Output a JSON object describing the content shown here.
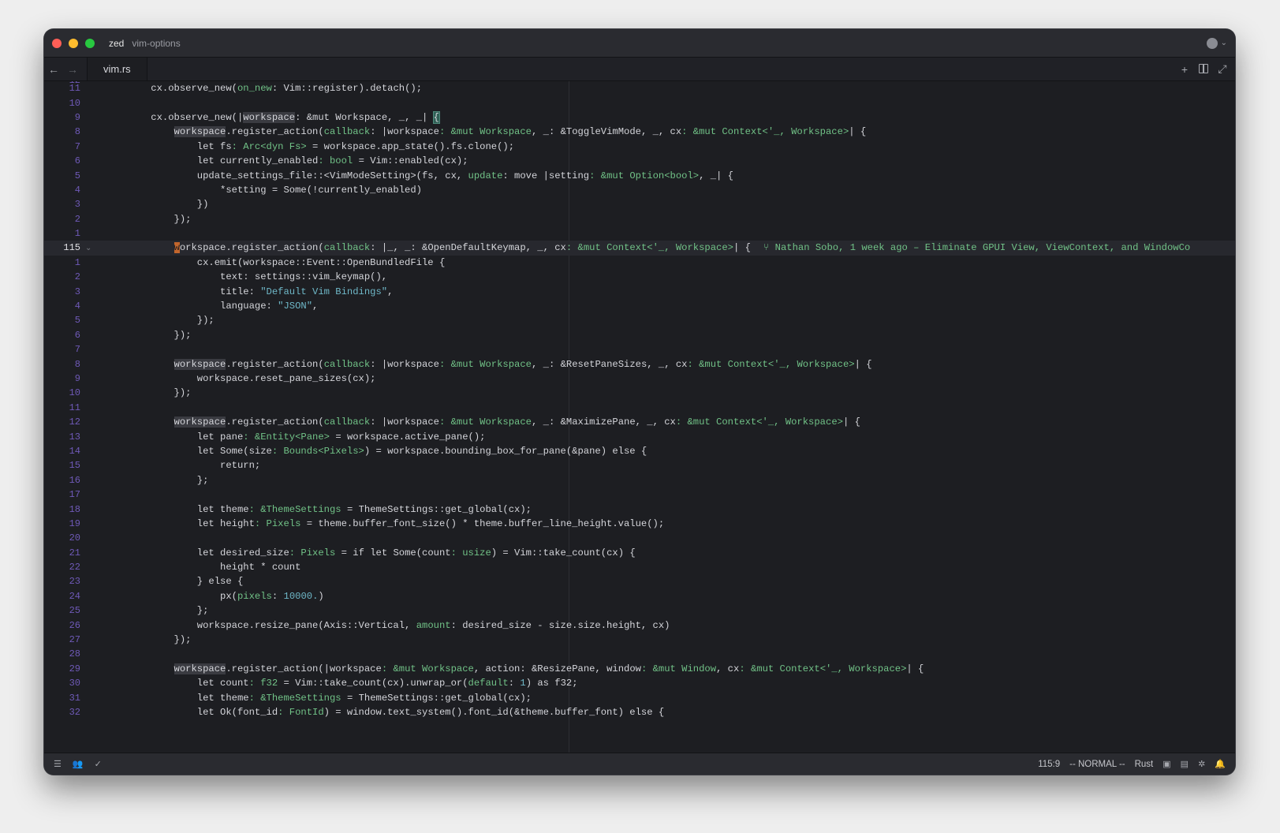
{
  "titlebar": {
    "app_name": "zed",
    "project_name": "vim-options"
  },
  "tabs": [
    {
      "label": "vim.rs",
      "active": true
    }
  ],
  "icons": {
    "back": "arrow-left-icon",
    "forward": "arrow-right-icon",
    "new": "plus-icon",
    "split": "split-pane-icon",
    "zoom": "expand-icon"
  },
  "editor": {
    "partial_top_line_number": "12",
    "lines": [
      {
        "n": "11",
        "parts": [
          [
            "    cx.observe_new(",
            ""
          ],
          [
            "on_new",
            "ty"
          ],
          [
            ": Vim::register).detach();",
            ""
          ]
        ]
      },
      {
        "n": "10",
        "parts": [
          [
            "",
            ""
          ]
        ]
      },
      {
        "n": "9",
        "parts": [
          [
            "    cx.observe_new(|",
            ""
          ],
          [
            "workspace",
            "hl"
          ],
          [
            ": &mut Workspace, _, _| ",
            ""
          ],
          [
            "{",
            "br"
          ]
        ]
      },
      {
        "n": "8",
        "parts": [
          [
            "        ",
            ""
          ],
          [
            "workspace",
            "hl"
          ],
          [
            ".register_action(",
            ""
          ],
          [
            "callback",
            "ty"
          ],
          [
            ": |workspace",
            ""
          ],
          [
            ": &mut Workspace",
            "ty"
          ],
          [
            ", _: &ToggleVimMode, _, cx",
            ""
          ],
          [
            ": &mut Context<'_, Workspace>",
            "ty"
          ],
          [
            "| {",
            ""
          ]
        ]
      },
      {
        "n": "7",
        "parts": [
          [
            "            let fs",
            ""
          ],
          [
            ": Arc<dyn Fs>",
            "ty"
          ],
          [
            " = workspace.app_state().fs.clone();",
            ""
          ]
        ]
      },
      {
        "n": "6",
        "parts": [
          [
            "            let currently_enabled",
            ""
          ],
          [
            ": bool",
            "ty"
          ],
          [
            " = Vim::enabled(cx);",
            ""
          ]
        ]
      },
      {
        "n": "5",
        "parts": [
          [
            "            update_settings_file::<VimModeSetting>(fs, cx, ",
            ""
          ],
          [
            "update",
            "ty"
          ],
          [
            ": move |setting",
            ""
          ],
          [
            ": &mut Option<bool>",
            "ty"
          ],
          [
            ", _| {",
            ""
          ]
        ]
      },
      {
        "n": "4",
        "parts": [
          [
            "                *setting = Some(!currently_enabled)",
            ""
          ]
        ]
      },
      {
        "n": "3",
        "parts": [
          [
            "            })",
            ""
          ]
        ]
      },
      {
        "n": "2",
        "parts": [
          [
            "        });",
            ""
          ]
        ]
      },
      {
        "n": "1",
        "parts": [
          [
            "",
            ""
          ]
        ]
      },
      {
        "n": "115",
        "active": true,
        "fold": "⌄",
        "cursor_char": "w",
        "parts": [
          [
            "orkspace.register_action(",
            ""
          ],
          [
            "callback",
            "ty"
          ],
          [
            ": |_, _: &OpenDefaultKeymap, _, cx",
            ""
          ],
          [
            ": &mut Context<'_, Workspace>",
            "ty"
          ],
          [
            "| {",
            ""
          ]
        ],
        "blame": "⑂ Nathan Sobo, 1 week ago – Eliminate GPUI View, ViewContext, and WindowCo"
      },
      {
        "n": "1",
        "parts": [
          [
            "            cx.emit(workspace::Event::OpenBundledFile {",
            ""
          ]
        ]
      },
      {
        "n": "2",
        "parts": [
          [
            "                text: settings::vim_keymap(),",
            ""
          ]
        ]
      },
      {
        "n": "3",
        "parts": [
          [
            "                title: ",
            ""
          ],
          [
            "\"Default Vim Bindings\"",
            "str"
          ],
          [
            ",",
            ""
          ]
        ]
      },
      {
        "n": "4",
        "parts": [
          [
            "                language: ",
            ""
          ],
          [
            "\"JSON\"",
            "str"
          ],
          [
            ",",
            ""
          ]
        ]
      },
      {
        "n": "5",
        "parts": [
          [
            "            });",
            ""
          ]
        ]
      },
      {
        "n": "6",
        "parts": [
          [
            "        });",
            ""
          ]
        ]
      },
      {
        "n": "7",
        "parts": [
          [
            "",
            ""
          ]
        ]
      },
      {
        "n": "8",
        "parts": [
          [
            "        ",
            ""
          ],
          [
            "workspace",
            "hl"
          ],
          [
            ".register_action(",
            ""
          ],
          [
            "callback",
            "ty"
          ],
          [
            ": |workspace",
            ""
          ],
          [
            ": &mut Workspace",
            "ty"
          ],
          [
            ", _: &ResetPaneSizes, _, cx",
            ""
          ],
          [
            ": &mut Context<'_, Workspace>",
            "ty"
          ],
          [
            "| {",
            ""
          ]
        ]
      },
      {
        "n": "9",
        "parts": [
          [
            "            workspace.reset_pane_sizes(cx);",
            ""
          ]
        ]
      },
      {
        "n": "10",
        "parts": [
          [
            "        });",
            ""
          ]
        ]
      },
      {
        "n": "11",
        "parts": [
          [
            "",
            ""
          ]
        ]
      },
      {
        "n": "12",
        "parts": [
          [
            "        ",
            ""
          ],
          [
            "workspace",
            "hl"
          ],
          [
            ".register_action(",
            ""
          ],
          [
            "callback",
            "ty"
          ],
          [
            ": |workspace",
            ""
          ],
          [
            ": &mut Workspace",
            "ty"
          ],
          [
            ", _: &MaximizePane, _, cx",
            ""
          ],
          [
            ": &mut Context<'_, Workspace>",
            "ty"
          ],
          [
            "| {",
            ""
          ]
        ]
      },
      {
        "n": "13",
        "parts": [
          [
            "            let pane",
            ""
          ],
          [
            ": &Entity<Pane>",
            "ty"
          ],
          [
            " = workspace.active_pane();",
            ""
          ]
        ]
      },
      {
        "n": "14",
        "parts": [
          [
            "            let Some(size",
            ""
          ],
          [
            ": Bounds<Pixels>",
            "ty"
          ],
          [
            ") = workspace.bounding_box_for_pane(&pane) else {",
            ""
          ]
        ]
      },
      {
        "n": "15",
        "parts": [
          [
            "                return;",
            ""
          ]
        ]
      },
      {
        "n": "16",
        "parts": [
          [
            "            };",
            ""
          ]
        ]
      },
      {
        "n": "17",
        "parts": [
          [
            "",
            ""
          ]
        ]
      },
      {
        "n": "18",
        "parts": [
          [
            "            let theme",
            ""
          ],
          [
            ": &ThemeSettings",
            "ty"
          ],
          [
            " = ThemeSettings::get_global(cx);",
            ""
          ]
        ]
      },
      {
        "n": "19",
        "parts": [
          [
            "            let height",
            ""
          ],
          [
            ": Pixels",
            "ty"
          ],
          [
            " = theme.buffer_font_size() * theme.buffer_line_height.value();",
            ""
          ]
        ]
      },
      {
        "n": "20",
        "parts": [
          [
            "",
            ""
          ]
        ]
      },
      {
        "n": "21",
        "parts": [
          [
            "            let desired_size",
            ""
          ],
          [
            ": Pixels",
            "ty"
          ],
          [
            " = if let Some(count",
            ""
          ],
          [
            ": usize",
            "ty"
          ],
          [
            ") = Vim::take_count(cx) {",
            ""
          ]
        ]
      },
      {
        "n": "22",
        "parts": [
          [
            "                height * count",
            ""
          ]
        ]
      },
      {
        "n": "23",
        "parts": [
          [
            "            } else {",
            ""
          ]
        ]
      },
      {
        "n": "24",
        "parts": [
          [
            "                px(",
            ""
          ],
          [
            "pixels",
            "ty"
          ],
          [
            ": ",
            ""
          ],
          [
            "10000.",
            "str"
          ],
          [
            ")",
            ""
          ]
        ]
      },
      {
        "n": "25",
        "parts": [
          [
            "            };",
            ""
          ]
        ]
      },
      {
        "n": "26",
        "parts": [
          [
            "            workspace.resize_pane(Axis::Vertical, ",
            ""
          ],
          [
            "amount",
            "ty"
          ],
          [
            ": desired_size - size.size.height, cx)",
            ""
          ]
        ]
      },
      {
        "n": "27",
        "parts": [
          [
            "        });",
            ""
          ]
        ]
      },
      {
        "n": "28",
        "parts": [
          [
            "",
            ""
          ]
        ]
      },
      {
        "n": "29",
        "parts": [
          [
            "        ",
            ""
          ],
          [
            "workspace",
            "hl"
          ],
          [
            ".register_action(|workspace",
            ""
          ],
          [
            ": &mut Workspace",
            "ty"
          ],
          [
            ", action: &ResizePane, window",
            ""
          ],
          [
            ": &mut Window",
            "ty"
          ],
          [
            ", cx",
            ""
          ],
          [
            ": &mut Context<'_, Workspace>",
            "ty"
          ],
          [
            "| {",
            ""
          ]
        ]
      },
      {
        "n": "30",
        "parts": [
          [
            "            let count",
            ""
          ],
          [
            ": f32",
            "ty"
          ],
          [
            " = Vim::take_count(cx).unwrap_or(",
            ""
          ],
          [
            "default",
            "ty"
          ],
          [
            ": ",
            ""
          ],
          [
            "1",
            "str"
          ],
          [
            ") as f32;",
            ""
          ]
        ]
      },
      {
        "n": "31",
        "parts": [
          [
            "            let theme",
            ""
          ],
          [
            ": &ThemeSettings",
            "ty"
          ],
          [
            " = ThemeSettings::get_global(cx);",
            ""
          ]
        ]
      },
      {
        "n": "32",
        "parts": [
          [
            "            let Ok(font_id",
            ""
          ],
          [
            ": FontId",
            "ty"
          ],
          [
            ") = window.text_system().font_id(&theme.buffer_font) else {",
            ""
          ]
        ]
      }
    ]
  },
  "statusbar": {
    "cursor_position": "115:9",
    "vim_mode": "-- NORMAL --",
    "language": "Rust"
  },
  "colors": {
    "background": "#1d1e22",
    "line_number": "#6f5ab8",
    "type": "#71c287",
    "string": "#6fb8c8",
    "cursor": "#c2662d"
  }
}
